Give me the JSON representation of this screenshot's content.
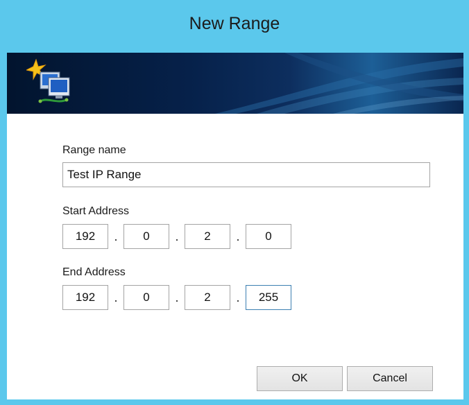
{
  "window": {
    "title": "New Range"
  },
  "form": {
    "range_name": {
      "label": "Range name",
      "value": "Test IP Range"
    },
    "start_address": {
      "label": "Start Address",
      "octets": [
        "192",
        "0",
        "2",
        "0"
      ]
    },
    "end_address": {
      "label": "End Address",
      "octets": [
        "192",
        "0",
        "2",
        "255"
      ]
    },
    "separator": "."
  },
  "buttons": {
    "ok": "OK",
    "cancel": "Cancel"
  },
  "icons": {
    "banner": "new-ip-range-icon"
  }
}
